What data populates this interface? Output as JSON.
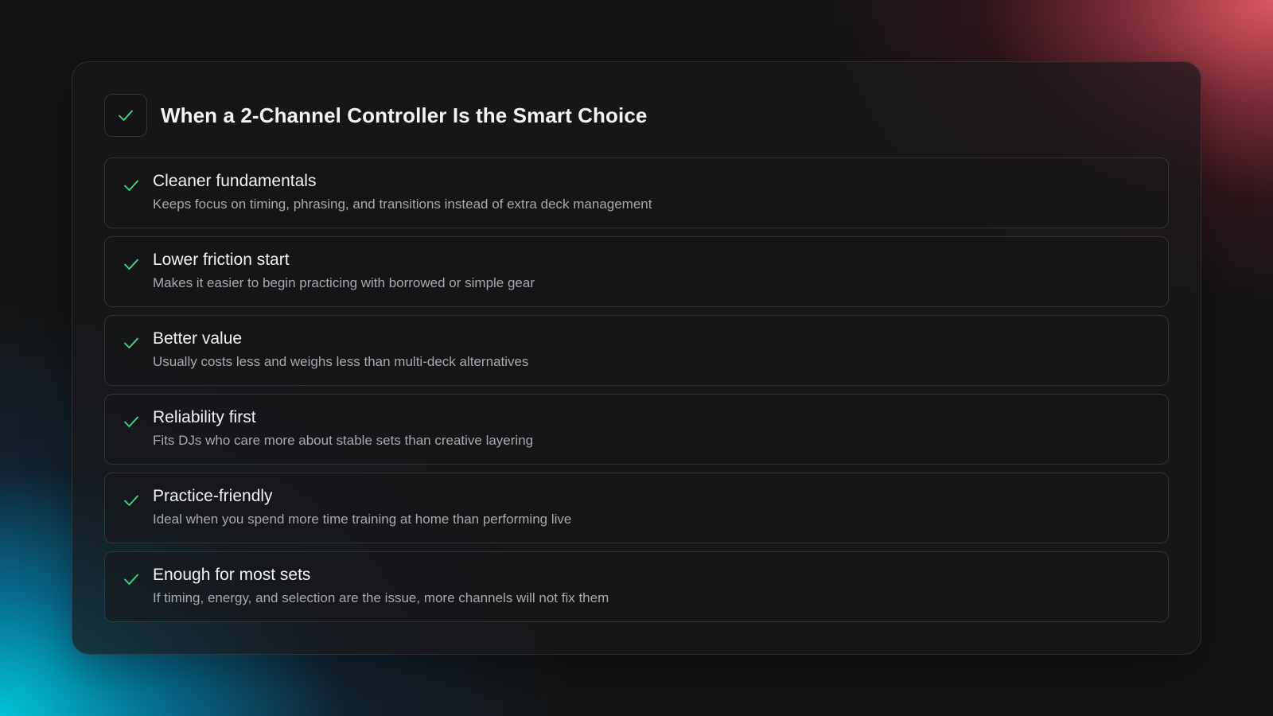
{
  "colors": {
    "accent_check": "#3ddc84",
    "background": "#141414",
    "glow_top_right": "#e75c62",
    "glow_bottom_left": "#00cde1"
  },
  "card": {
    "header_icon": "check-icon",
    "title": "When a 2-Channel Controller Is the Smart Choice",
    "items": [
      {
        "icon": "check-icon",
        "title": "Cleaner fundamentals",
        "description": "Keeps focus on timing, phrasing, and transitions instead of extra deck management"
      },
      {
        "icon": "check-icon",
        "title": "Lower friction start",
        "description": "Makes it easier to begin practicing with borrowed or simple gear"
      },
      {
        "icon": "check-icon",
        "title": "Better value",
        "description": "Usually costs less and weighs less than multi-deck alternatives"
      },
      {
        "icon": "check-icon",
        "title": "Reliability first",
        "description": "Fits DJs who care more about stable sets than creative layering"
      },
      {
        "icon": "check-icon",
        "title": "Practice-friendly",
        "description": "Ideal when you spend more time training at home than performing live"
      },
      {
        "icon": "check-icon",
        "title": "Enough for most sets",
        "description": "If timing, energy, and selection are the issue, more channels will not fix them"
      }
    ]
  }
}
